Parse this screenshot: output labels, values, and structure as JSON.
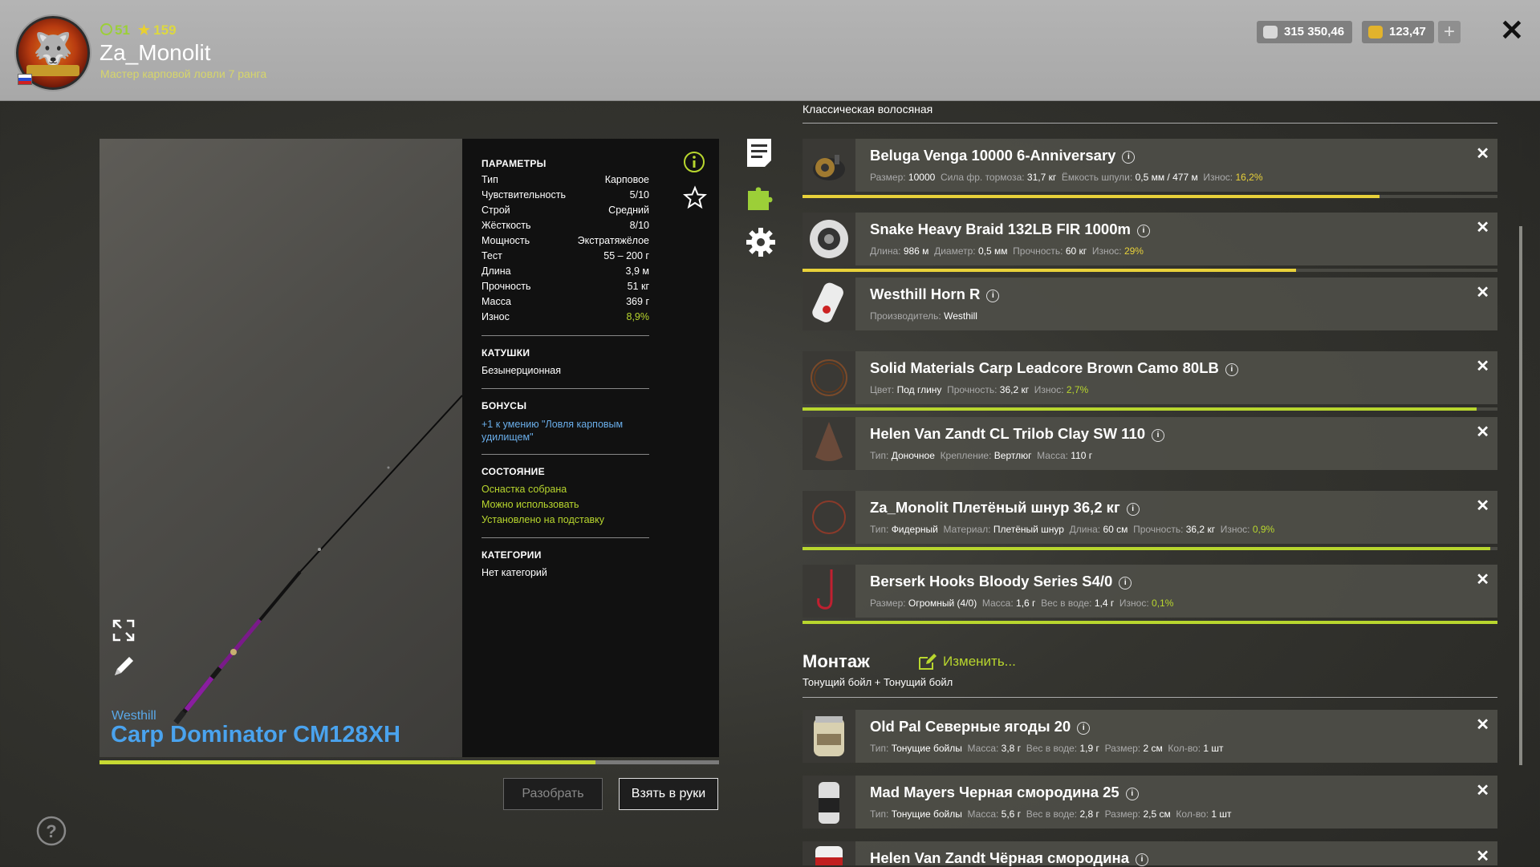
{
  "player": {
    "level": "51",
    "stars": "159",
    "username": "Za_Monolit",
    "rank": "Мастер карповой ловли 7 ранга"
  },
  "currency": {
    "silver": "315 350,46",
    "gold": "123,47"
  },
  "rod": {
    "brand": "Westhill",
    "model": "Carp Dominator CM128XH",
    "progress": 0.8
  },
  "params": {
    "title": "ПАРАМЕТРЫ",
    "rows": [
      {
        "k": "Тип",
        "v": "Карповое"
      },
      {
        "k": "Чувствительность",
        "v": "5/10"
      },
      {
        "k": "Строй",
        "v": "Средний"
      },
      {
        "k": "Жёсткость",
        "v": "8/10"
      },
      {
        "k": "Мощность",
        "v": "Экстратяжёлое"
      },
      {
        "k": "Тест",
        "v": "55 – 200 г"
      },
      {
        "k": "Длина",
        "v": "3,9 м"
      },
      {
        "k": "Прочность",
        "v": "51 кг"
      },
      {
        "k": "Масса",
        "v": "369 г"
      },
      {
        "k": "Износ",
        "v": "8,9%"
      }
    ],
    "reels_title": "КАТУШКИ",
    "reels_value": "Безынерционная",
    "bonus_title": "БОНУСЫ",
    "bonus_value": "+1 к умению \"Ловля карповым удилищем\"",
    "state_title": "СОСТОЯНИЕ",
    "state_values": [
      "Оснастка собрана",
      "Можно использовать",
      "Установлено на подставку"
    ],
    "cat_title": "КАТЕГОРИИ",
    "cat_value": "Нет категорий"
  },
  "buttons": {
    "disassemble": "Разобрать",
    "take": "Взять в руки"
  },
  "list": {
    "header": "Классическая волосяная",
    "items": [
      {
        "name": "Beluga Venga 10000 6-Anniversary",
        "desc": [
          [
            "Размер:",
            "10000"
          ],
          [
            "Сила фр. тормоза:",
            "31,7 кг"
          ],
          [
            "Ёмкость шпули:",
            "0,5 мм / 477 м"
          ]
        ],
        "wear_label": "Износ:",
        "wear": "16,2%",
        "bar": 0.83
      },
      {
        "name": "Snake Heavy Braid 132LB FIR 1000m",
        "desc": [
          [
            "Длина:",
            "986 м"
          ],
          [
            "Диаметр:",
            "0,5 мм"
          ],
          [
            "Прочность:",
            "60 кг"
          ]
        ],
        "wear_label": "Износ:",
        "wear": "29%",
        "bar": 0.71
      },
      {
        "name": "Westhill Horn R",
        "desc": [
          [
            "Производитель:",
            "Westhill"
          ]
        ],
        "wear_label": "",
        "wear": "",
        "bar": null
      },
      {
        "name": "Solid Materials Carp Leadcore Brown Camo 80LB",
        "desc": [
          [
            "Цвет:",
            "Под глину"
          ],
          [
            "Прочность:",
            "36,2 кг"
          ]
        ],
        "wear_label": "Износ:",
        "wear": "2,7%",
        "bar": 0.97
      },
      {
        "name": "Helen Van Zandt CL Trilob Clay SW 110",
        "desc": [
          [
            "Тип:",
            "Доночное"
          ],
          [
            "Крепление:",
            "Вертлюг"
          ],
          [
            "Масса:",
            "110 г"
          ]
        ],
        "wear_label": "",
        "wear": "",
        "bar": null
      },
      {
        "name": "Za_Monolit Плетёный шнур 36,2 кг",
        "desc": [
          [
            "Тип:",
            "Фидерный"
          ],
          [
            "Материал:",
            "Плетёный шнур"
          ],
          [
            "Длина:",
            "60 см"
          ],
          [
            "Прочность:",
            "36,2 кг"
          ]
        ],
        "wear_label": "Износ:",
        "wear": "0,9%",
        "bar": 0.99
      },
      {
        "name": "Berserk Hooks Bloody Series S4/0",
        "desc": [
          [
            "Размер:",
            "Огромный (4/0)"
          ],
          [
            "Масса:",
            "1,6 г"
          ],
          [
            "Вес в воде:",
            "1,4 г"
          ]
        ],
        "wear_label": "Износ:",
        "wear": "0,1%",
        "bar": 1.0
      }
    ],
    "montazh_title": "Монтаж",
    "montazh_edit": "Изменить...",
    "bait_combo": "Тонущий бойл + Тонущий бойл",
    "baits": [
      {
        "name": "Old Pal Северные ягоды 20",
        "desc": [
          [
            "Тип:",
            "Тонущие бойлы"
          ],
          [
            "Масса:",
            "3,8 г"
          ],
          [
            "Вес в воде:",
            "1,9 г"
          ],
          [
            "Размер:",
            "2 см"
          ],
          [
            "Кол-во:",
            "1 шт"
          ]
        ]
      },
      {
        "name": "Mad Mayers Черная смородина 25",
        "desc": [
          [
            "Тип:",
            "Тонущие бойлы"
          ],
          [
            "Масса:",
            "5,6 г"
          ],
          [
            "Вес в воде:",
            "2,8 г"
          ],
          [
            "Размер:",
            "2,5 см"
          ],
          [
            "Кол-во:",
            "1 шт"
          ]
        ]
      },
      {
        "name": "Helen Van Zandt Чёрная смородина",
        "desc": []
      }
    ]
  },
  "colors": {
    "accent_green": "#b8d62e",
    "accent_yellow": "#e8d13a",
    "title_blue": "#4aa3ee"
  }
}
